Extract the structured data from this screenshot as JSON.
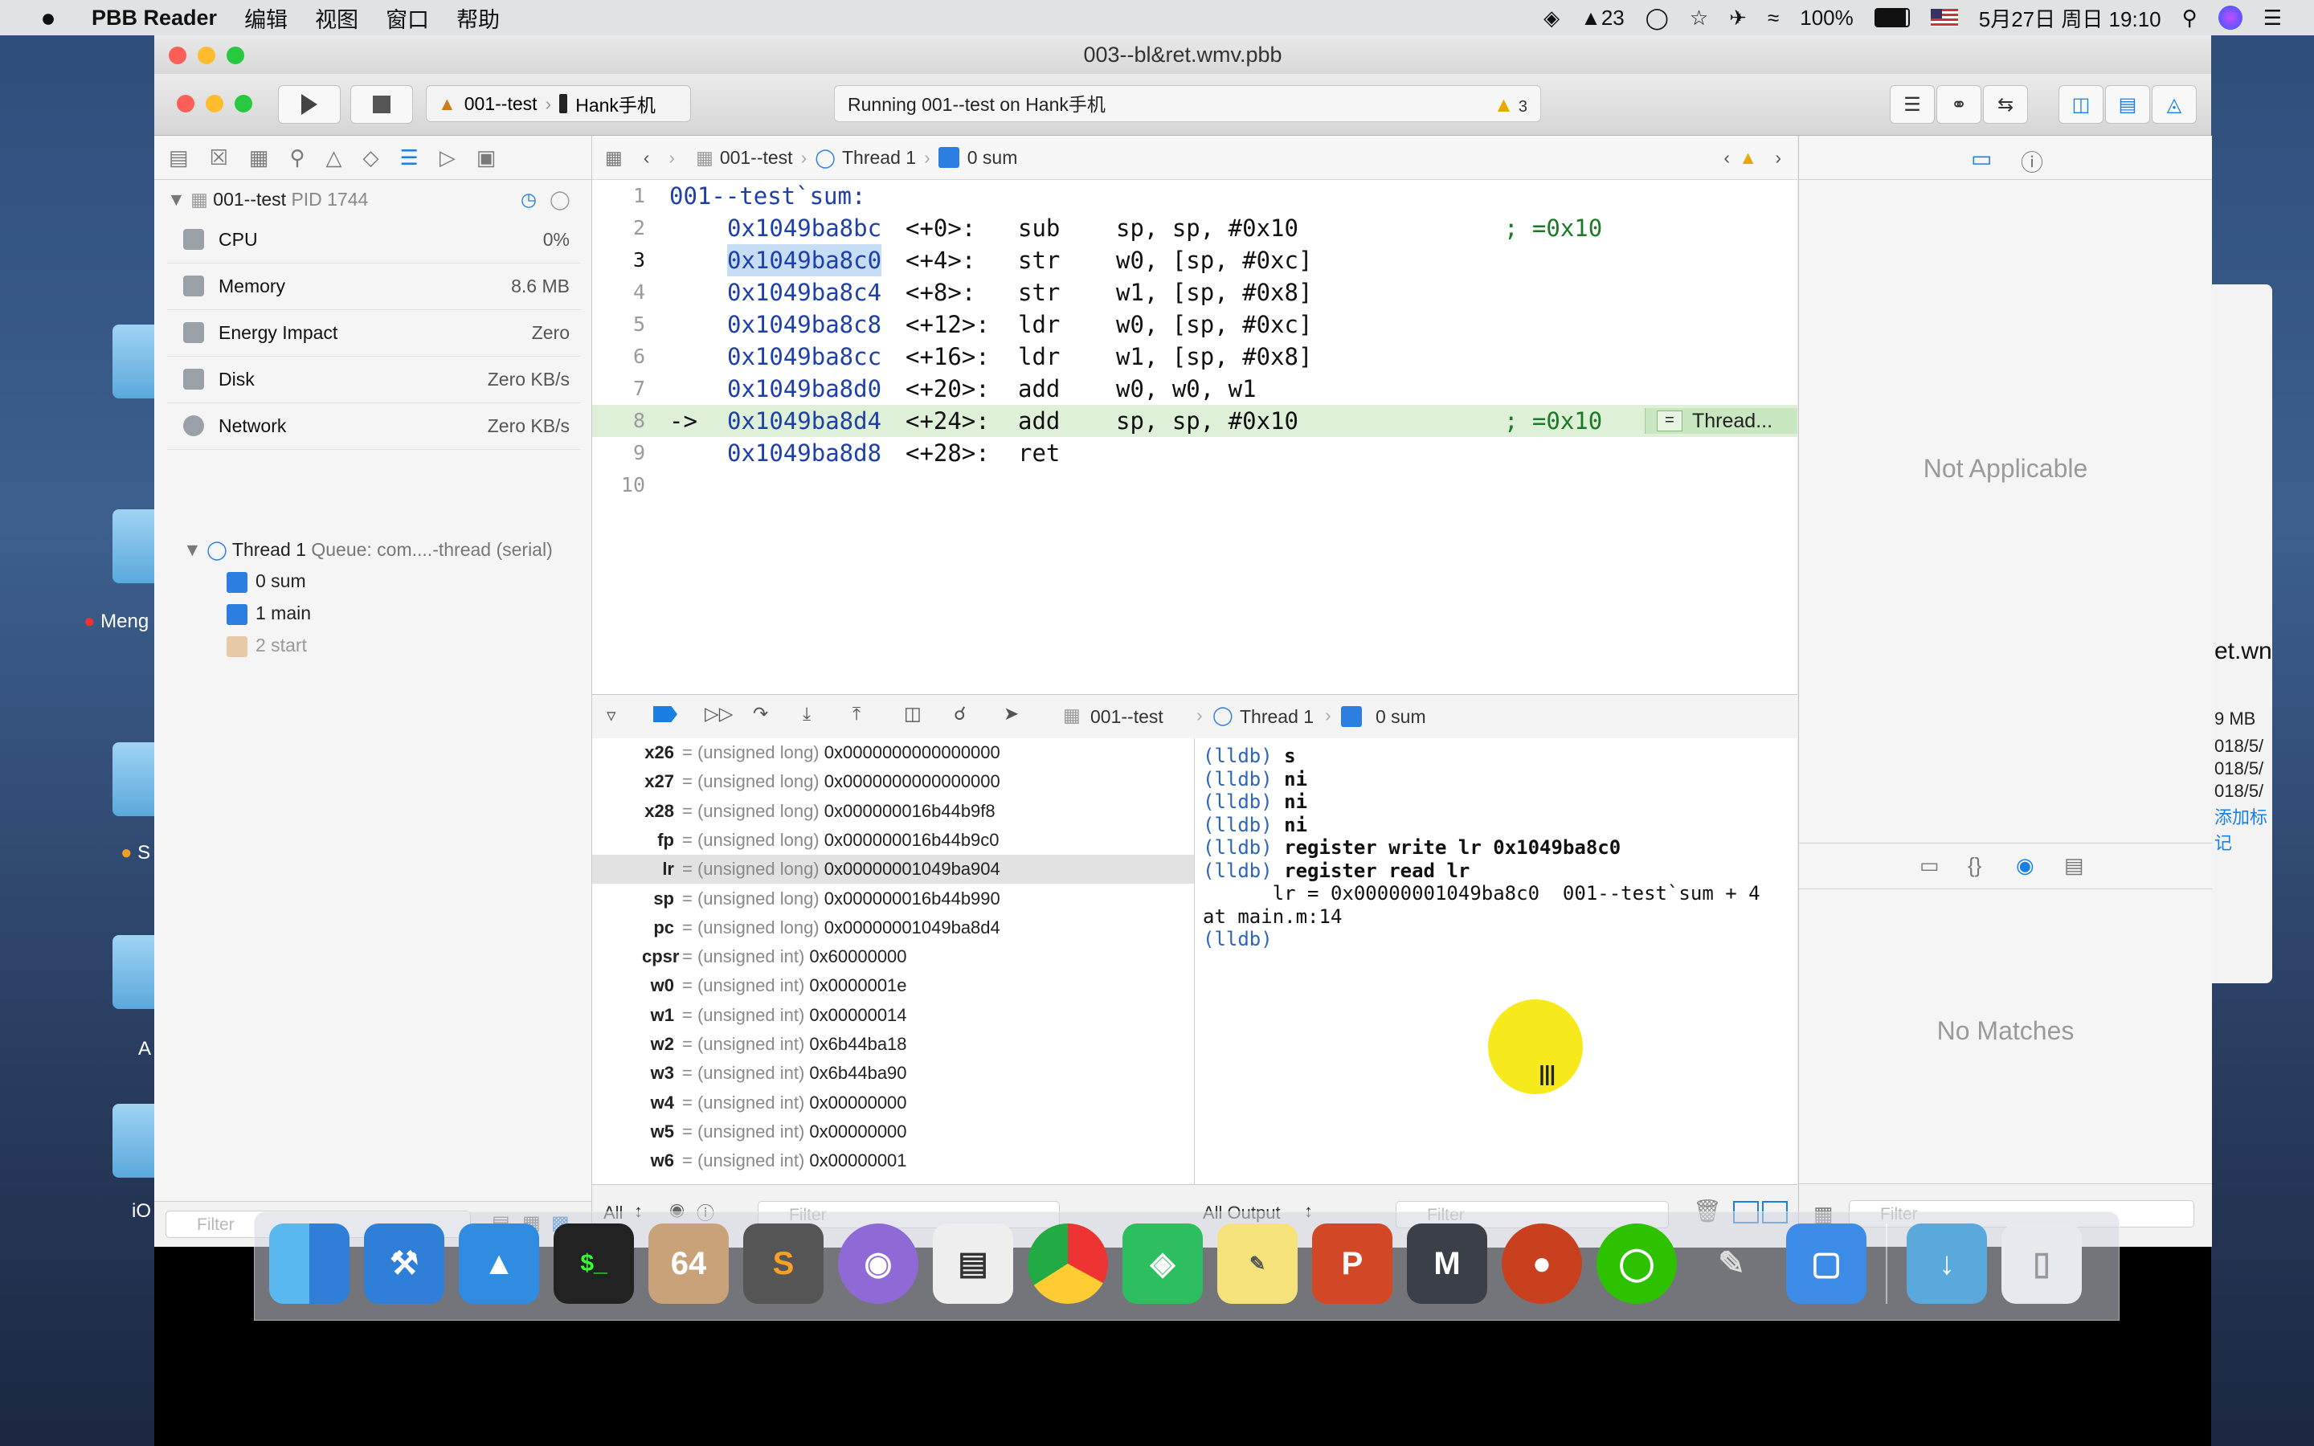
{
  "menubar": {
    "app_name": "PBB Reader",
    "items": [
      "编辑",
      "视图",
      "窗口",
      "帮助"
    ],
    "qq_badge": "23",
    "battery": "100%",
    "datetime": "5月27日 周日 19:10"
  },
  "desktop": {
    "labels": [
      "Meng",
      "S",
      "A",
      "iO",
      "et.wn",
      "9 MB",
      "018/5/",
      "018/5/",
      "018/5/",
      "添加标记"
    ]
  },
  "window": {
    "title": "003--bl&ret.wmv.pbb"
  },
  "toolbar": {
    "scheme_target": "001--test",
    "scheme_device": "Hank手机",
    "activity_text": "Running 001--test on Hank手机",
    "warning_count": "3"
  },
  "navigator": {
    "process_name": "001--test",
    "process_pid": "PID 1744",
    "gauges": [
      {
        "label": "CPU",
        "value": "0%"
      },
      {
        "label": "Memory",
        "value": "8.6 MB"
      },
      {
        "label": "Energy Impact",
        "value": "Zero"
      },
      {
        "label": "Disk",
        "value": "Zero KB/s"
      },
      {
        "label": "Network",
        "value": "Zero KB/s"
      }
    ],
    "thread_label": "Thread 1",
    "thread_queue": "Queue: com....-thread (serial)",
    "frames": [
      "0 sum",
      "1 main",
      "2 start"
    ],
    "filter_placeholder": "Filter"
  },
  "editor": {
    "jump": {
      "project": "001--test",
      "thread": "Thread 1",
      "frame": "0 sum"
    },
    "lines": [
      {
        "num": "1",
        "text": "001--test`sum:"
      },
      {
        "num": "2",
        "addr": "0x1049ba8bc",
        "off": "<+0>:",
        "ins": "sub",
        "ops": "sp, sp, #0x10",
        "cmt": "; =0x10"
      },
      {
        "num": "3",
        "addr": "0x1049ba8c0",
        "off": "<+4>:",
        "ins": "str",
        "ops": "w0, [sp, #0xc]"
      },
      {
        "num": "4",
        "addr": "0x1049ba8c4",
        "off": "<+8>:",
        "ins": "str",
        "ops": "w1, [sp, #0x8]"
      },
      {
        "num": "5",
        "addr": "0x1049ba8c8",
        "off": "<+12>:",
        "ins": "ldr",
        "ops": "w0, [sp, #0xc]"
      },
      {
        "num": "6",
        "addr": "0x1049ba8cc",
        "off": "<+16>:",
        "ins": "ldr",
        "ops": "w1, [sp, #0x8]"
      },
      {
        "num": "7",
        "addr": "0x1049ba8d0",
        "off": "<+20>:",
        "ins": "add",
        "ops": "w0, w0, w1"
      },
      {
        "num": "8",
        "arrow": "->",
        "addr": "0x1049ba8d4",
        "off": "<+24>:",
        "ins": "add",
        "ops": "sp, sp, #0x10",
        "cmt": "; =0x10",
        "badge": "Thread..."
      },
      {
        "num": "9",
        "addr": "0x1049ba8d8",
        "off": "<+28>:",
        "ins": "ret"
      },
      {
        "num": "10"
      }
    ]
  },
  "debug": {
    "jump": {
      "project": "001--test",
      "thread": "Thread 1",
      "frame": "0 sum"
    },
    "variables": [
      {
        "name": "x26",
        "type": "(unsigned long)",
        "value": "0x0000000000000000"
      },
      {
        "name": "x27",
        "type": "(unsigned long)",
        "value": "0x0000000000000000"
      },
      {
        "name": "x28",
        "type": "(unsigned long)",
        "value": "0x000000016b44b9f8"
      },
      {
        "name": "fp",
        "type": "(unsigned long)",
        "value": "0x000000016b44b9c0"
      },
      {
        "name": "lr",
        "type": "(unsigned long)",
        "value": "0x00000001049ba904"
      },
      {
        "name": "sp",
        "type": "(unsigned long)",
        "value": "0x000000016b44b990"
      },
      {
        "name": "pc",
        "type": "(unsigned long)",
        "value": "0x00000001049ba8d4"
      },
      {
        "name": "cpsr",
        "type": "(unsigned int)",
        "value": "0x60000000"
      },
      {
        "name": "w0",
        "type": "(unsigned int)",
        "value": "0x0000001e"
      },
      {
        "name": "w1",
        "type": "(unsigned int)",
        "value": "0x00000014"
      },
      {
        "name": "w2",
        "type": "(unsigned int)",
        "value": "0x6b44ba18"
      },
      {
        "name": "w3",
        "type": "(unsigned int)",
        "value": "0x6b44ba90"
      },
      {
        "name": "w4",
        "type": "(unsigned int)",
        "value": "0x00000000"
      },
      {
        "name": "w5",
        "type": "(unsigned int)",
        "value": "0x00000000"
      },
      {
        "name": "w6",
        "type": "(unsigned int)",
        "value": "0x00000001"
      }
    ],
    "console": [
      {
        "prompt": "(lldb)",
        "cmd": "s"
      },
      {
        "prompt": "(lldb)",
        "cmd": "ni"
      },
      {
        "prompt": "(lldb)",
        "cmd": "ni"
      },
      {
        "prompt": "(lldb)",
        "cmd": "ni"
      },
      {
        "prompt": "(lldb)",
        "cmd": "register write lr 0x1049ba8c0"
      },
      {
        "prompt": "(lldb)",
        "cmd": "register read lr"
      },
      {
        "output": "      lr = 0x00000001049ba8c0  001--test`sum + 4"
      },
      {
        "output": "at main.m:14"
      },
      {
        "prompt": "(lldb)",
        "cmd": ""
      }
    ],
    "scope_select": "All",
    "output_select": "All Output",
    "filter_placeholder": "Filter"
  },
  "inspector": {
    "top_message": "Not Applicable",
    "bottom_message": "No Matches",
    "filter_placeholder": "Filter"
  },
  "colors": {
    "accent": "#1a7fe3",
    "pc_line": "#dff0d8",
    "address": "#1c3fa8",
    "comment": "#1b7a26",
    "lldb_prompt": "#2d66b8",
    "cursor_highlight": "#f6ea1c"
  }
}
